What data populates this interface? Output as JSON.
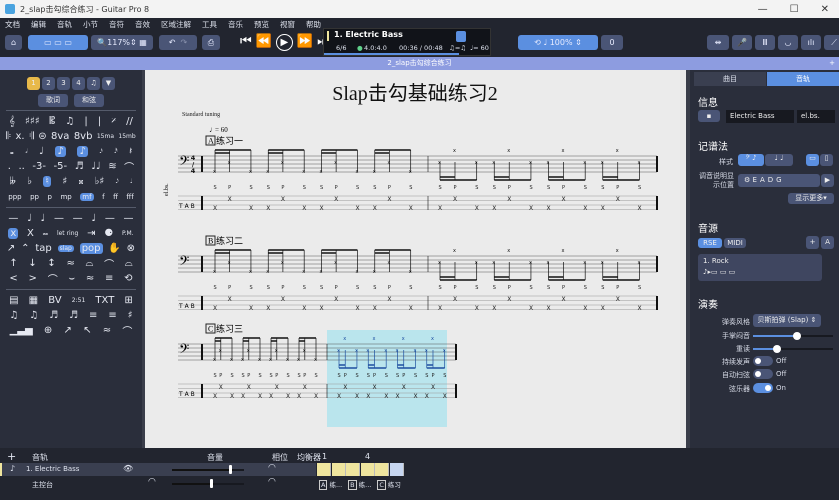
{
  "window": {
    "title": "2_slap击勾综合练习 - Guitar Pro 8",
    "controls": [
      "—",
      "☐",
      "✕"
    ]
  },
  "menu": [
    "文档",
    "编辑",
    "音轨",
    "小节",
    "音符",
    "音效",
    "区域注解",
    "工具",
    "音乐",
    "预览",
    "视窗",
    "帮助"
  ],
  "toolbar": {
    "zoom": "117%",
    "speed": "100%",
    "transpose": "0",
    "home_icon": "⌂",
    "undo": "↶",
    "redo": "↷",
    "print": "⎙",
    "transport": [
      "⏮",
      "⏪",
      "▶",
      "⏩",
      "⏭"
    ],
    "right_icons": [
      "⇹",
      "🎤",
      "Ⅲ",
      "◡",
      "ılı",
      "⟋"
    ]
  },
  "lcd": {
    "track": "1. Electric Bass",
    "bar": "6/6",
    "beat": "4.0:4.0",
    "time": "00:36 / 00:48",
    "swing": "♫=♫",
    "tempo": "♩= 60"
  },
  "doc_tab": "2_slap击勾综合练习",
  "palette": {
    "pages": [
      "1",
      "2",
      "3",
      "4"
    ],
    "lyrics": "歌词",
    "chords": "和弦",
    "rows": [
      [
        "𝄞",
        "♯♯♯",
        "𝄡",
        "♫",
        "|",
        "|",
        "𝄎",
        "//"
      ],
      [
        "𝄆",
        "x.",
        "𝄇",
        "⊜",
        "8va",
        "8vb",
        "15ma",
        "15mb"
      ],
      [
        "𝅝",
        "𝅗𝅥",
        "♩",
        "♪",
        "♪",
        "𝅘𝅥𝅯",
        "𝅘𝅥𝅰",
        "𝄽"
      ],
      [
        ".",
        "..",
        "-3-",
        "-5-",
        "♬",
        "♩♩",
        "≋",
        "⌒"
      ],
      [
        "𝄫",
        "♭",
        "♮",
        "♯",
        "𝄪",
        "♭♯",
        "𝅘𝅥𝅮",
        "𝅘𝅥"
      ],
      [
        "ppp",
        "pp",
        "p",
        "mp",
        "mf",
        "f",
        "ff",
        "fff"
      ],
      [
        "—",
        "♩",
        "♩",
        "—",
        "—",
        "♩",
        "—",
        "—"
      ],
      [
        "x",
        "X",
        "𝆗",
        "let ring",
        "⇥",
        "⚈",
        "P.M."
      ],
      [
        "↗",
        "⌃",
        "tap",
        "slap",
        "pop",
        "✋",
        "⊗"
      ],
      [
        "↑",
        "↓",
        "↕",
        "≈",
        "⌓",
        "⌒",
        "⌓"
      ],
      [
        "<",
        ">",
        "⌒",
        "⌣",
        "≈",
        "≡",
        "⟲"
      ],
      [
        "▤",
        "▦",
        "BV",
        "2:51",
        "TXT",
        "⊞"
      ],
      [
        "♫",
        "♫",
        "♬",
        "♬",
        "≡",
        "≡",
        "♯"
      ],
      [
        "▁▃▅",
        "⊕",
        "↗",
        "↖",
        "≈",
        "⌒"
      ]
    ]
  },
  "score": {
    "title": "Slap击勾基础练习2",
    "tuning": "Standard tuning",
    "tempo": "= 60",
    "track_abbr": "el.bs.",
    "sections": [
      {
        "letter": "A",
        "name": "练习一"
      },
      {
        "letter": "B",
        "name": "练习二"
      },
      {
        "letter": "C",
        "name": "练习三"
      }
    ],
    "tab_clef": "T A B",
    "time_sig": "4/4"
  },
  "right_panel": {
    "tabs": [
      "曲目",
      "音轨"
    ],
    "info_title": "信息",
    "track_name": "Electric Bass",
    "track_short": "el.bs.",
    "notation_title": "记谱法",
    "style_label": "样式",
    "tuning_label": "调音说明显示位置",
    "tuning": "EADG",
    "show_more": "显示更多▾",
    "sound_title": "音源",
    "rse": "RSE",
    "midi": "MIDI",
    "sound_name": "1. Rock",
    "perf_title": "演奏",
    "play_style_label": "弹奏风格",
    "play_style": "贝斯拍弹 (Slap)",
    "palm_label": "手掌闷音",
    "palm_value": 0.55,
    "accent_label": "重读",
    "accent_value": 0.3,
    "sustain_label": "持续发声",
    "sustain": "Off",
    "autobrush_label": "自动扫弦",
    "autobrush": "Off",
    "strings_label": "弦乐器",
    "strings": "On"
  },
  "bottom": {
    "add": "+",
    "tracks_header": "音轨",
    "volume_header": "音量",
    "pan_header": "相位",
    "eq_header": "均衡器",
    "bar_numbers": [
      "1",
      "4"
    ],
    "track": "1. Electric Bass",
    "master": "主控台",
    "track_volume": 0.85,
    "master_volume": 0.58,
    "markers": [
      {
        "letter": "A",
        "name": "练..."
      },
      {
        "letter": "B",
        "name": "练..."
      },
      {
        "letter": "C",
        "name": "练习"
      }
    ]
  },
  "colors": {
    "accent": "#5b8fe0",
    "doc_tab": "#8d9ce0",
    "bar_cell": "#efe59e",
    "selection": "#aee3ee"
  }
}
